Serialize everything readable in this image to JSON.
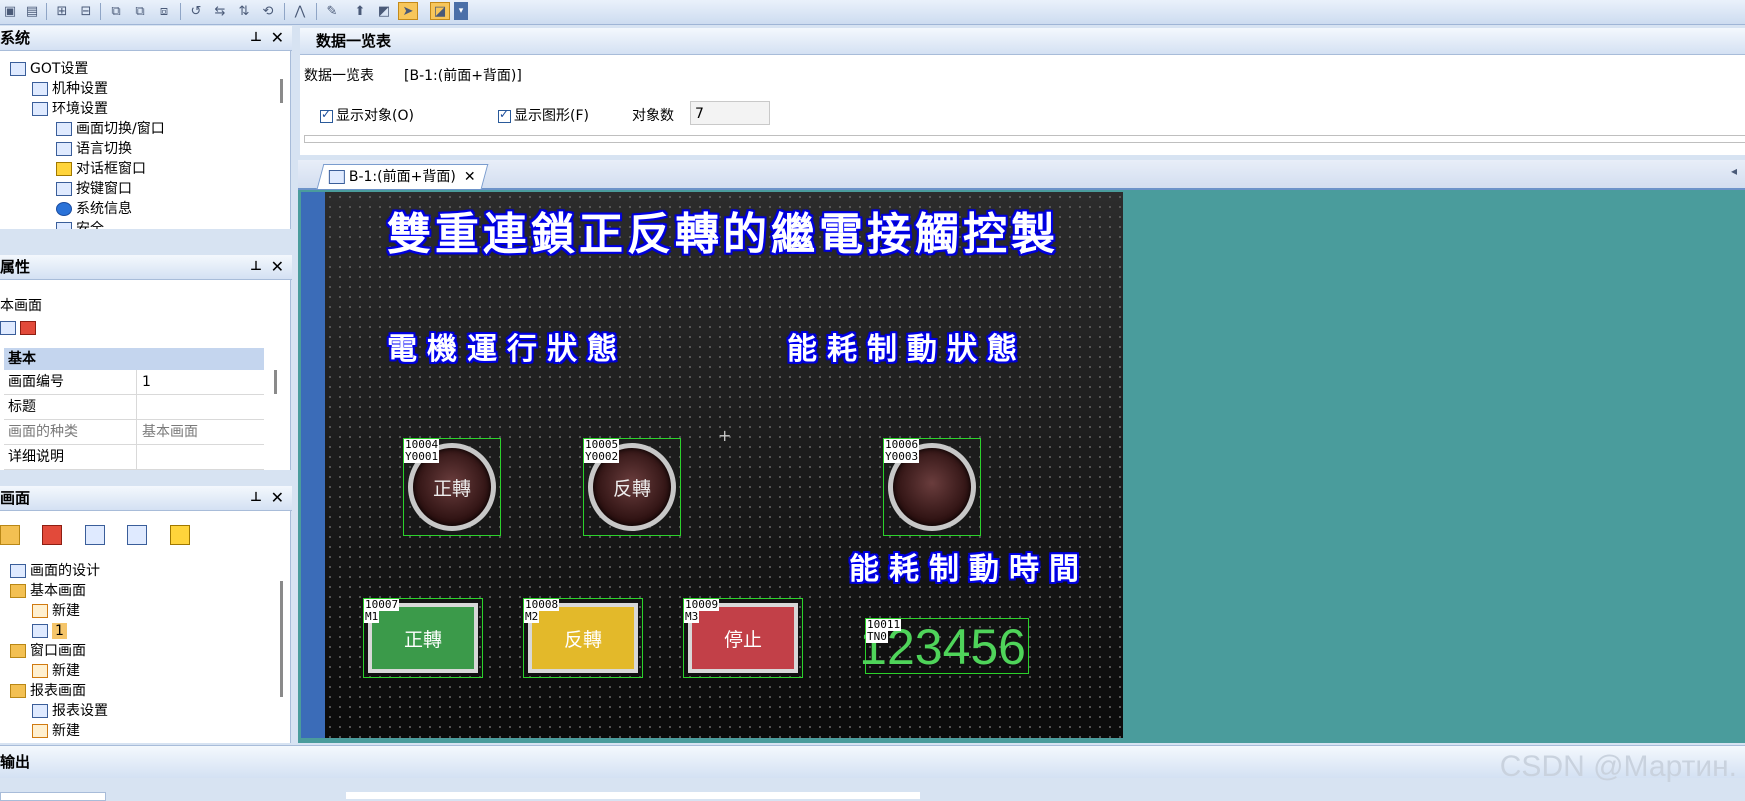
{
  "panels": {
    "system": {
      "title": "系统",
      "tree": [
        "GOT设置",
        "机种设置",
        "环境设置",
        "画面切换/窗口",
        "语言切换",
        "对话框窗口",
        "按键窗口",
        "系统信息",
        "安全"
      ]
    },
    "properties": {
      "title": "属性",
      "subtitle": "本画面",
      "section": "基本",
      "rows": [
        {
          "key": "画面编号",
          "value": "1"
        },
        {
          "key": "标题",
          "value": ""
        },
        {
          "key": "画面的种类",
          "value": "基本画面"
        },
        {
          "key": "详细说明",
          "value": ""
        }
      ]
    },
    "screen": {
      "title": "画面",
      "tree": [
        "画面的设计",
        "基本画面",
        "新建",
        "1",
        "窗口画面",
        "新建",
        "报表画面",
        "报表设置",
        "新建"
      ]
    }
  },
  "main": {
    "title": "数据一览表",
    "list_label": "数据一览表",
    "list_target": "[B-1:(前面+背面)]",
    "show_objects": "显示对象(O)",
    "show_shapes": "显示图形(F)",
    "object_count_label": "对象数",
    "object_count": "7",
    "tab_label": "B-1:(前面+背面)"
  },
  "hmi": {
    "title": "雙重連鎖正反轉的繼電接觸控製",
    "motor_status": "電機運行狀態",
    "brake_status": "能耗制動狀態",
    "brake_time": "能耗制動時間",
    "lamps": [
      {
        "id": "10004",
        "dev": "Y0001",
        "label": "正轉"
      },
      {
        "id": "10005",
        "dev": "Y0002",
        "label": "反轉"
      },
      {
        "id": "10006",
        "dev": "Y0003",
        "label": ""
      }
    ],
    "buttons": [
      {
        "id": "10007",
        "dev": "M1",
        "label": "正轉",
        "color": "#3b9a4a"
      },
      {
        "id": "10008",
        "dev": "M2",
        "label": "反轉",
        "color": "#e3b92a"
      },
      {
        "id": "10009",
        "dev": "M3",
        "label": "停止",
        "color": "#c24048"
      }
    ],
    "numeric": {
      "id": "10011",
      "dev": "TN0",
      "value": "123456"
    }
  },
  "output": {
    "title": "输出"
  },
  "watermark": "CSDN @Мартин."
}
